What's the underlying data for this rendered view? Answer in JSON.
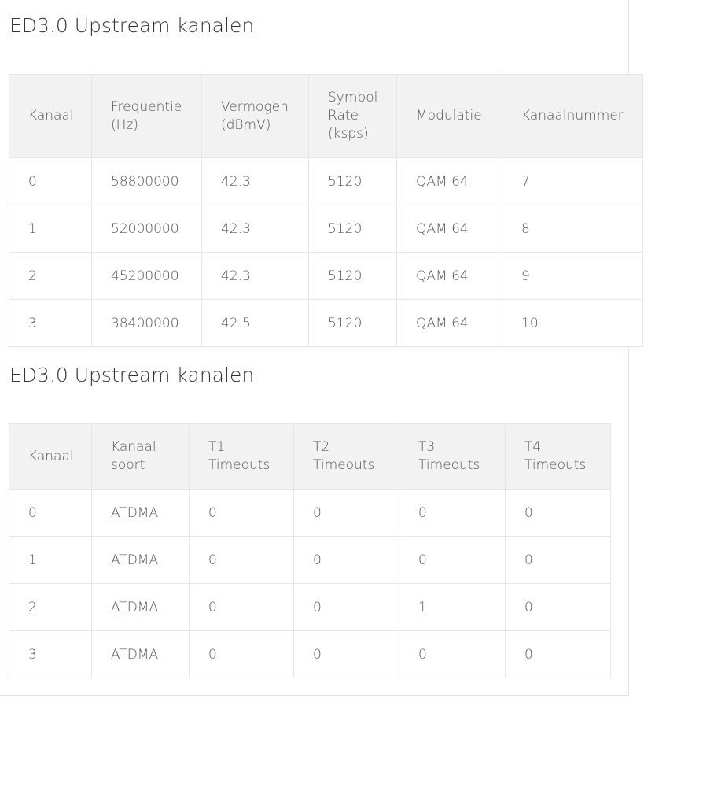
{
  "sections": [
    {
      "title": "ED3.0 Upstream kanalen",
      "headers": [
        "Kanaal",
        "Frequentie\n(Hz)",
        "Vermogen\n(dBmV)",
        "Symbol\nRate\n(ksps)",
        "Modulatie",
        "Kanaalnummer"
      ],
      "rows": [
        [
          "0",
          "58800000",
          "42.3",
          "5120",
          "QAM 64",
          "7"
        ],
        [
          "1",
          "52000000",
          "42.3",
          "5120",
          "QAM 64",
          "8"
        ],
        [
          "2",
          "45200000",
          "42.3",
          "5120",
          "QAM 64",
          "9"
        ],
        [
          "3",
          "38400000",
          "42.5",
          "5120",
          "QAM 64",
          "10"
        ]
      ]
    },
    {
      "title": "ED3.0 Upstream kanalen",
      "headers": [
        "Kanaal",
        "Kanaal\nsoort",
        "T1\nTimeouts",
        "T2\nTimeouts",
        "T3\nTimeouts",
        "T4\nTimeouts"
      ],
      "rows": [
        [
          "0",
          "ATDMA",
          "0",
          "0",
          "0",
          "0"
        ],
        [
          "1",
          "ATDMA",
          "0",
          "0",
          "0",
          "0"
        ],
        [
          "2",
          "ATDMA",
          "0",
          "0",
          "1",
          "0"
        ],
        [
          "3",
          "ATDMA",
          "0",
          "0",
          "0",
          "0"
        ]
      ]
    }
  ]
}
